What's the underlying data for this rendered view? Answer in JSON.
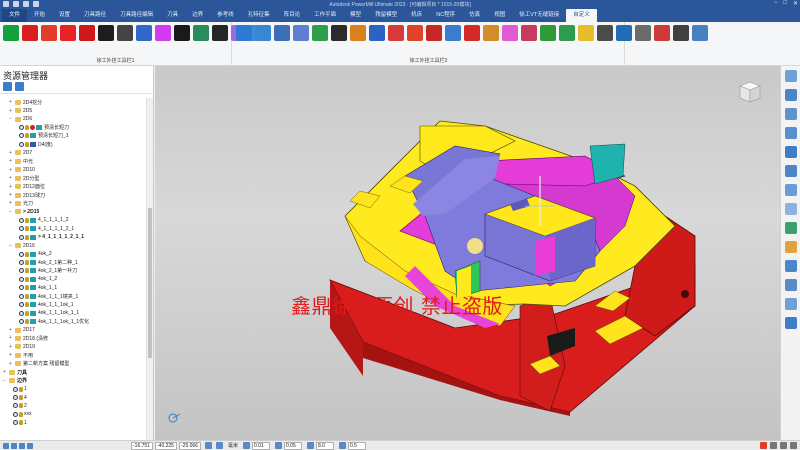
{
  "window": {
    "title": "Autodesk PowerMill Ultimate 2023 · [可编辑项目 * 1015-20模块]",
    "controls": [
      "−",
      "□",
      "✕"
    ]
  },
  "menu": {
    "tabs": [
      "文件",
      "开始",
      "设置",
      "刀具路径",
      "刀具路径编辑",
      "刀具",
      "边界",
      "参考线",
      "孔特征集",
      "阵目论",
      "工作平面",
      "模型",
      "残留模型",
      "机床",
      "NC程序",
      "仿真",
      "视图",
      "徐工VT无缝链接",
      "自定义"
    ],
    "active": "自定义"
  },
  "ribbon": {
    "group1_label": "徐工外挂工具栏1",
    "group2_label": "徐工外挂工具栏2",
    "group1_icons": [
      "tool-icon-d",
      "tool-icon-z",
      "tool-icon-z2",
      "tool-icon-a",
      "tool-icon-z3",
      "tool-icon-head",
      "tool-icon-blk",
      "tool-icon-person",
      "tool-icon-c",
      "tool-icon-dots",
      "tool-icon-curve",
      "tool-icon-dark",
      "tool-icon-cube",
      "tool-icon-sphere"
    ],
    "group2_icons": [
      "tool-icon-globe",
      "tool-icon-edit",
      "tool-icon-doc",
      "tool-icon-arrow",
      "tool-icon-green",
      "tool-icon-solid",
      "tool-icon-pen",
      "tool-icon-blue",
      "tool-icon-grid",
      "tool-icon-fire",
      "tool-icon-s",
      "tool-icon-sq",
      "tool-icon-red",
      "tool-icon-pencil",
      "tool-icon-paint",
      "tool-icon-sw",
      "tool-icon-globe2",
      "tool-icon-ok",
      "tool-icon-bolt",
      "tool-icon-grid2",
      "tool-icon-hex",
      "tool-icon-ref",
      "tool-icon-scissor",
      "tool-icon-text",
      "tool-icon-box"
    ]
  },
  "explorer": {
    "title": "资源管理器",
    "rows": [
      {
        "indent": 1,
        "kind": "folder",
        "label": "2D4挖分"
      },
      {
        "indent": 1,
        "kind": "folder",
        "label": "2D5"
      },
      {
        "indent": 1,
        "kind": "folder-open",
        "label": "2D6"
      },
      {
        "indent": 2,
        "kind": "tool-red",
        "label": "预清长短刀"
      },
      {
        "indent": 2,
        "kind": "tool",
        "label": "预清长短刀_1"
      },
      {
        "indent": 2,
        "kind": "tool-blue",
        "label": "D4(度)"
      },
      {
        "indent": 1,
        "kind": "folder",
        "label": "2D7"
      },
      {
        "indent": 1,
        "kind": "folder",
        "label": "中光"
      },
      {
        "indent": 1,
        "kind": "folder",
        "label": "2D10"
      },
      {
        "indent": 1,
        "kind": "folder",
        "label": "2D分型"
      },
      {
        "indent": 1,
        "kind": "folder",
        "label": "2D12面位"
      },
      {
        "indent": 1,
        "kind": "folder",
        "label": "2D13球刀"
      },
      {
        "indent": 1,
        "kind": "folder",
        "label": "光刀"
      },
      {
        "indent": 1,
        "kind": "folder-bold",
        "label": "> 2D15"
      },
      {
        "indent": 2,
        "kind": "tool",
        "label": "4_1_1_1_1_2"
      },
      {
        "indent": 2,
        "kind": "tool",
        "label": "4_1_1_1_1_2_1"
      },
      {
        "indent": 2,
        "kind": "tool-bold",
        "label": "> 4_1_1_1_1_2_1_1"
      },
      {
        "indent": 1,
        "kind": "folder-open",
        "label": "2D16"
      },
      {
        "indent": 2,
        "kind": "tool",
        "label": "4ok_2"
      },
      {
        "indent": 2,
        "kind": "tool",
        "label": "4ok_2_1第二种_1"
      },
      {
        "indent": 2,
        "kind": "tool",
        "label": "4ok_2_1第一补刀"
      },
      {
        "indent": 2,
        "kind": "tool",
        "label": "4ok_1_2"
      },
      {
        "indent": 2,
        "kind": "tool",
        "label": "4ok_1_1"
      },
      {
        "indent": 2,
        "kind": "tool",
        "label": "4ok_1_1_1镜夹_1"
      },
      {
        "indent": 2,
        "kind": "tool",
        "label": "4ok_1_1_1ok_1"
      },
      {
        "indent": 2,
        "kind": "tool",
        "label": "4ok_1_1_1ok_1_1"
      },
      {
        "indent": 2,
        "kind": "tool",
        "label": "4ok_1_1_1ok_1_1优化"
      },
      {
        "indent": 1,
        "kind": "folder",
        "label": "2D17"
      },
      {
        "indent": 1,
        "kind": "folder",
        "label": "2D18 (清修"
      },
      {
        "indent": 1,
        "kind": "folder",
        "label": "2D19"
      },
      {
        "indent": 1,
        "kind": "folder",
        "label": "不用"
      },
      {
        "indent": 1,
        "kind": "folder",
        "label": "第二新方案 残留模型"
      },
      {
        "indent": 0,
        "kind": "root",
        "label": "刀具"
      },
      {
        "indent": 0,
        "kind": "root-open",
        "label": "边界"
      },
      {
        "indent": 1,
        "kind": "bound",
        "label": "1"
      },
      {
        "indent": 1,
        "kind": "bound",
        "label": "4"
      },
      {
        "indent": 1,
        "kind": "bound",
        "label": "2"
      },
      {
        "indent": 1,
        "kind": "bound",
        "label": "xxx"
      },
      {
        "indent": 1,
        "kind": "bound",
        "label": "1"
      }
    ]
  },
  "viewport": {
    "watermark": "鑫鼎徐工原创 禁止盗版"
  },
  "status": {
    "coords": [
      "-16.751",
      "-40.225",
      "-25.066"
    ],
    "unit": "毫米",
    "tol1": "0.01",
    "tol2": "0.05",
    "dia": "8.0",
    "step": "0.5"
  },
  "colors": {
    "accent": "#2b579a",
    "part_red": "#dc1e1e",
    "part_yellow": "#ffee1a",
    "part_purple": "#7c76d8",
    "part_magenta": "#e53bd6"
  }
}
